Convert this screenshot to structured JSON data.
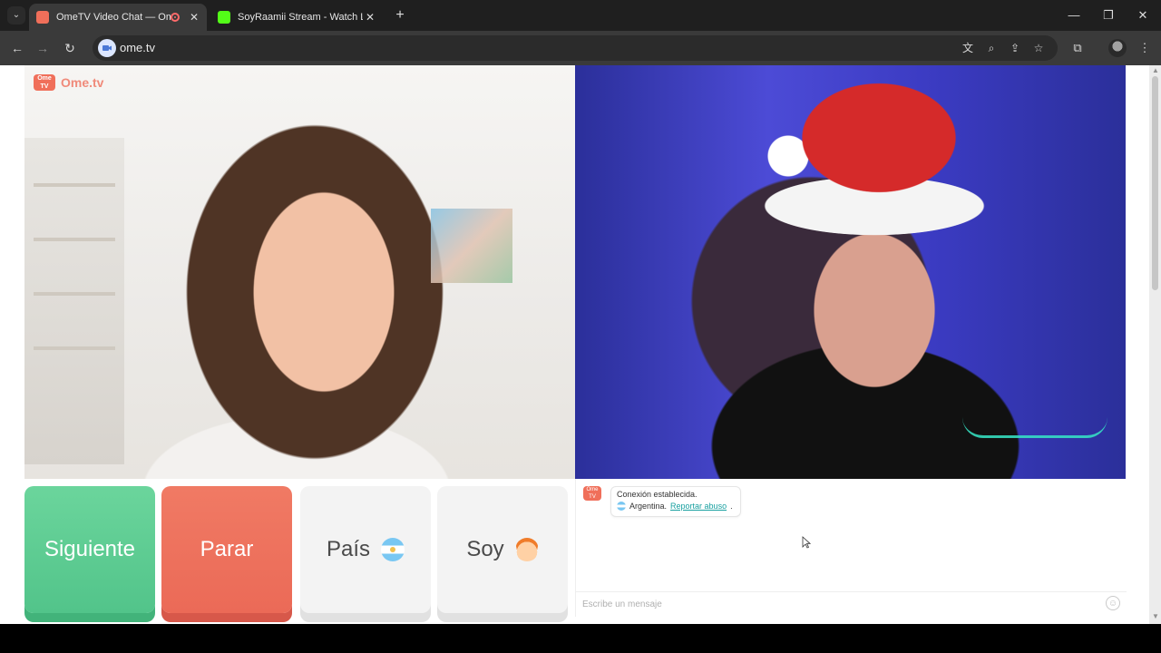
{
  "browser": {
    "tabs": [
      {
        "title": "OmeTV Video Chat — Ome",
        "active": true,
        "favicon_color": "#f06f5a"
      },
      {
        "title": "SoyRaamii Stream - Watch Live",
        "active": false,
        "favicon_color": "#53fc18"
      }
    ],
    "url": "ome.tv",
    "icons": {
      "tab_menu": "chevron-down-icon",
      "new_tab": "plus-icon",
      "back": "back-arrow-icon",
      "forward": "forward-arrow-icon",
      "reload": "reload-icon",
      "translate": "translate-icon",
      "zoom": "zoom-icon",
      "install": "install-icon",
      "bookmark": "star-icon",
      "extensions": "puzzle-icon",
      "menu": "kebab-menu-icon"
    }
  },
  "app": {
    "logo_text": "Ome.tv",
    "logo_mini": "Ome\nTV",
    "buttons": {
      "next": "Siguiente",
      "stop": "Parar",
      "country": "País",
      "me": "Soy"
    },
    "chat": {
      "system_message": "Conexión establecida.",
      "country": "Argentina.",
      "report_link": "Reportar abuso",
      "report_suffix": ".",
      "input_placeholder": "Escribe un mensaje"
    }
  },
  "colors": {
    "next": "#52c48a",
    "stop": "#eb6a57",
    "neutral": "#f3f3f3",
    "link": "#18a0a0"
  }
}
